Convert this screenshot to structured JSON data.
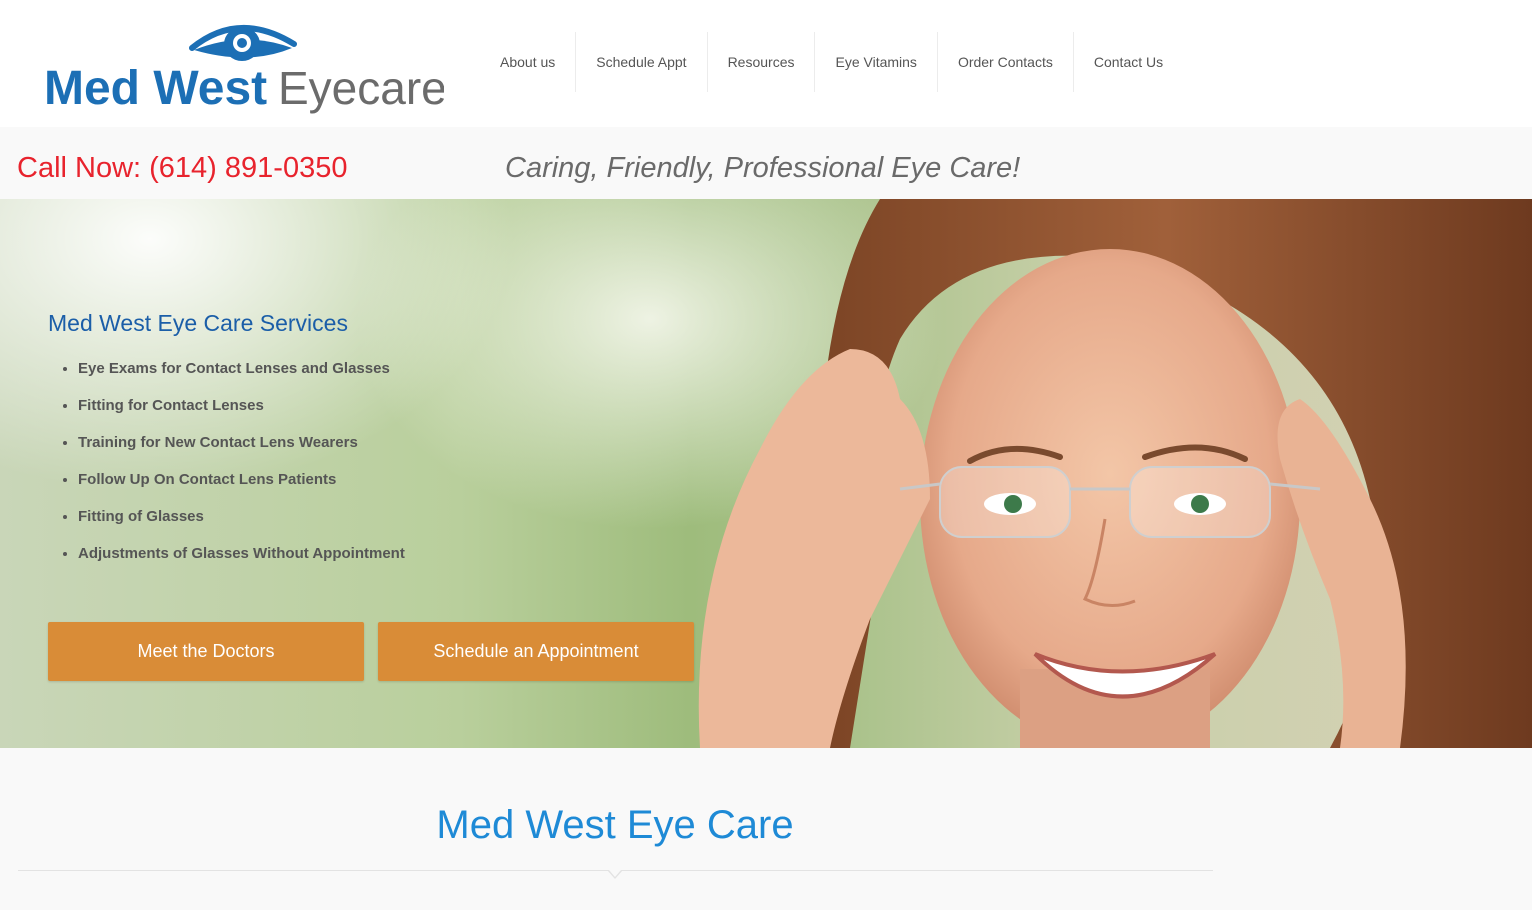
{
  "logo": {
    "text": "Med West Eyecare",
    "word1": "Med West",
    "word2": "Eyecare"
  },
  "nav": {
    "items": [
      {
        "label": "About us"
      },
      {
        "label": "Schedule Appt"
      },
      {
        "label": "Resources"
      },
      {
        "label": "Eye Vitamins"
      },
      {
        "label": "Order Contacts"
      },
      {
        "label": "Contact Us"
      }
    ]
  },
  "callbar": {
    "call_now": "Call Now: (614) 891-0350",
    "tagline": "Caring, Friendly, Professional Eye Care!"
  },
  "hero": {
    "services_title": "Med West Eye Care Services",
    "services": [
      "Eye Exams for Contact Lenses and Glasses",
      "Fitting for Contact Lenses",
      "Training for New Contact Lens Wearers",
      "Follow Up On Contact Lens Patients",
      "Fitting of Glasses",
      "Adjustments of Glasses Without Appointment"
    ],
    "buttons": {
      "meet_doctors": "Meet the Doctors",
      "schedule": "Schedule an Appointment"
    },
    "photo_icon": "woman-with-glasses-photo"
  },
  "section": {
    "title": "Med West Eye Care"
  },
  "colors": {
    "accent_red": "#e8232d",
    "brand_blue": "#1b5ea8",
    "title_blue": "#1e8ad6",
    "button_orange": "#d98c37"
  }
}
